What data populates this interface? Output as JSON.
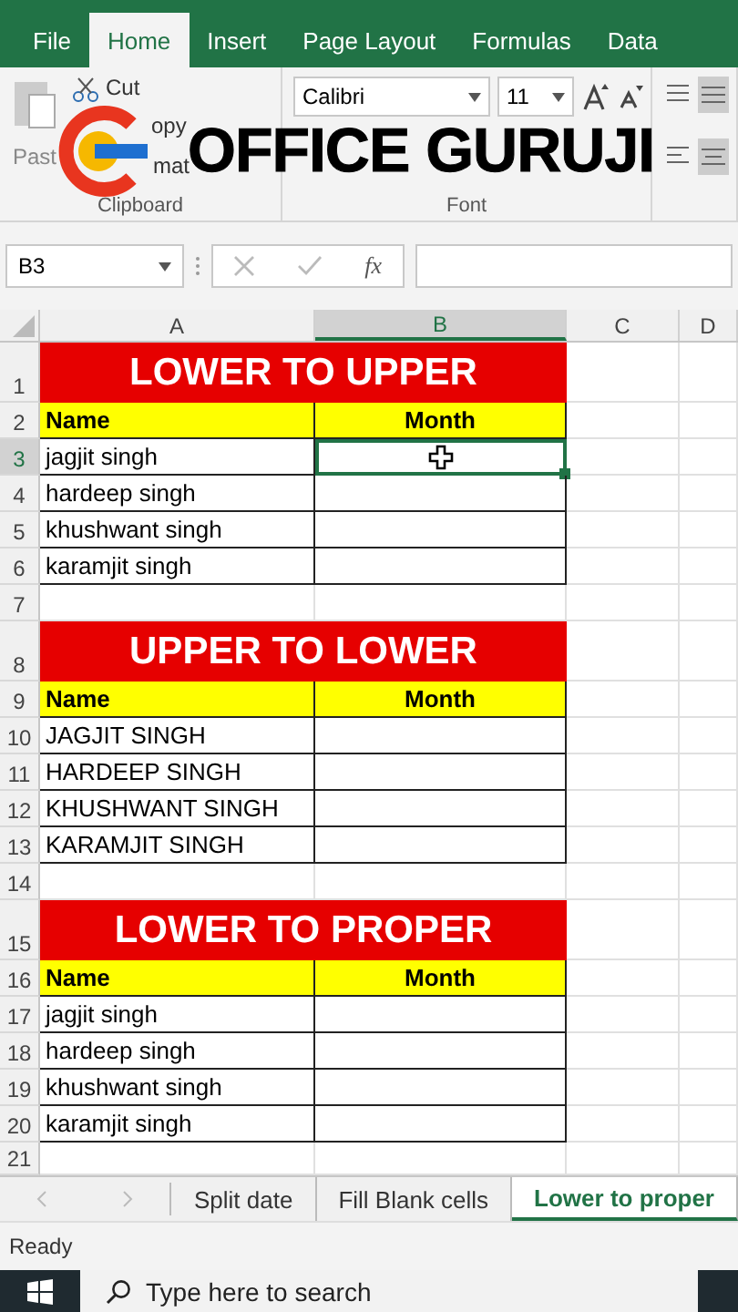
{
  "menu_tabs": [
    {
      "label": "File",
      "selected": false
    },
    {
      "label": "Home",
      "selected": true
    },
    {
      "label": "Insert",
      "selected": false
    },
    {
      "label": "Page Layout",
      "selected": false
    },
    {
      "label": "Formulas",
      "selected": false
    },
    {
      "label": "Data",
      "selected": false
    }
  ],
  "ribbon": {
    "paste_label": "Past",
    "cut_label": "Cut",
    "copy_label": "opy",
    "format_painter_label": "mat",
    "clipboard_group": "Clipboard",
    "font_name": "Calibri",
    "font_size": "11",
    "font_group": "Font"
  },
  "overlay_logo": {
    "text": "OFFICE GURUJI"
  },
  "formula_bar": {
    "name_box": "B3",
    "function_label": "fx"
  },
  "columns": [
    {
      "label": "A",
      "selected": false
    },
    {
      "label": "B",
      "selected": true
    },
    {
      "label": "C",
      "selected": false
    },
    {
      "label": "D",
      "selected": false
    }
  ],
  "rows": [
    {
      "number": "1",
      "kind": "title",
      "text": "LOWER TO UPPER",
      "selected": false
    },
    {
      "number": "2",
      "kind": "header",
      "a": "Name",
      "b": "Month",
      "selected": false
    },
    {
      "number": "3",
      "kind": "data",
      "a": "jagjit singh",
      "selected": true
    },
    {
      "number": "4",
      "kind": "data",
      "a": "hardeep singh",
      "selected": false
    },
    {
      "number": "5",
      "kind": "data",
      "a": "khushwant singh",
      "selected": false
    },
    {
      "number": "6",
      "kind": "data",
      "a": "karamjit singh",
      "selected": false
    },
    {
      "number": "7",
      "kind": "blank",
      "selected": false
    },
    {
      "number": "8",
      "kind": "title",
      "text": "UPPER TO LOWER",
      "selected": false
    },
    {
      "number": "9",
      "kind": "header",
      "a": "Name",
      "b": "Month",
      "selected": false
    },
    {
      "number": "10",
      "kind": "data",
      "a": "JAGJIT SINGH",
      "selected": false
    },
    {
      "number": "11",
      "kind": "data",
      "a": "HARDEEP SINGH",
      "selected": false
    },
    {
      "number": "12",
      "kind": "data",
      "a": "KHUSHWANT SINGH",
      "selected": false
    },
    {
      "number": "13",
      "kind": "data",
      "a": "KARAMJIT SINGH",
      "selected": false
    },
    {
      "number": "14",
      "kind": "blank",
      "selected": false
    },
    {
      "number": "15",
      "kind": "title",
      "text": "LOWER TO PROPER",
      "selected": false
    },
    {
      "number": "16",
      "kind": "header",
      "a": "Name",
      "b": "Month",
      "selected": false
    },
    {
      "number": "17",
      "kind": "data",
      "a": "jagjit singh",
      "selected": false
    },
    {
      "number": "18",
      "kind": "data",
      "a": "hardeep singh",
      "selected": false
    },
    {
      "number": "19",
      "kind": "data",
      "a": "khushwant singh",
      "selected": false
    },
    {
      "number": "20",
      "kind": "data",
      "a": "karamjit singh",
      "selected": false
    },
    {
      "number": "21",
      "kind": "blank",
      "selected": false
    }
  ],
  "sheet_tabs": [
    {
      "label": "Split date",
      "selected": false
    },
    {
      "label": "Fill Blank cells",
      "selected": false
    },
    {
      "label": "Lower to proper",
      "selected": true
    }
  ],
  "status_bar": {
    "text": "Ready"
  },
  "taskbar": {
    "search_placeholder": "Type here to search"
  }
}
